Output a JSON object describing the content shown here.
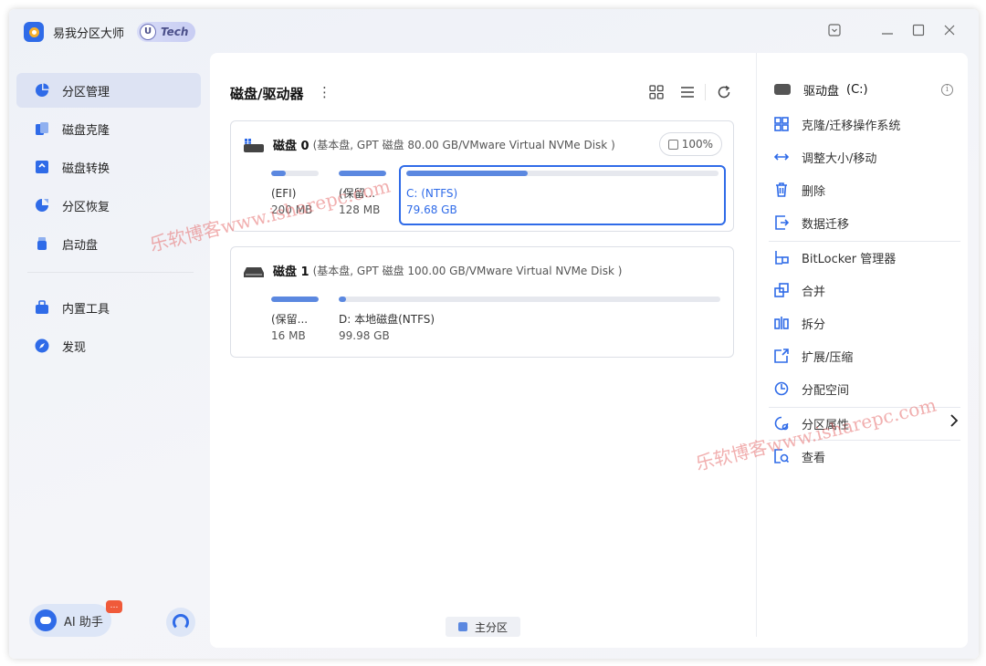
{
  "app": {
    "title": "易我分区大师",
    "badge": "Tech"
  },
  "sidebar": {
    "items": [
      {
        "label": "分区管理"
      },
      {
        "label": "磁盘克隆"
      },
      {
        "label": "磁盘转换"
      },
      {
        "label": "分区恢复"
      },
      {
        "label": "启动盘"
      },
      {
        "label": "内置工具"
      },
      {
        "label": "发现"
      }
    ],
    "ai_label": "AI 助手",
    "ai_badge": "…"
  },
  "main": {
    "title": "磁盘/驱动器",
    "disks": [
      {
        "name": "磁盘 0",
        "info": "(基本盘, GPT 磁盘 80.00 GB/VMware Virtual NVMe Disk )",
        "health": "100%",
        "partitions": [
          {
            "label": "(EFI)",
            "size": "200 MB",
            "used": 0.3
          },
          {
            "label": "(保留...",
            "size": "128 MB",
            "used": 1.0
          },
          {
            "label": "C: (NTFS)",
            "size": "79.68 GB",
            "used": 0.39
          }
        ]
      },
      {
        "name": "磁盘 1",
        "info": "(基本盘, GPT 磁盘 100.00 GB/VMware Virtual NVMe Disk )",
        "partitions": [
          {
            "label": "(保留...",
            "size": "16 MB",
            "used": 1.0
          },
          {
            "label": "D: 本地磁盘(NTFS)",
            "size": "99.98 GB",
            "used": 0.01
          }
        ]
      }
    ],
    "legend": "主分区"
  },
  "actions": {
    "drive": "驱动盘",
    "drive_letter": "(C:)",
    "items": [
      "克隆/迁移操作系统",
      "调整大小/移动",
      "删除",
      "数据迁移",
      "BitLocker 管理器",
      "合并",
      "拆分",
      "扩展/压缩",
      "分配空间",
      "分区属性",
      "查看"
    ]
  },
  "watermark": "乐软博客www.isharepc.com",
  "colors": {
    "accent": "#2f6be8",
    "bar": "#5b88e0",
    "active_bg": "#dde3f3"
  }
}
